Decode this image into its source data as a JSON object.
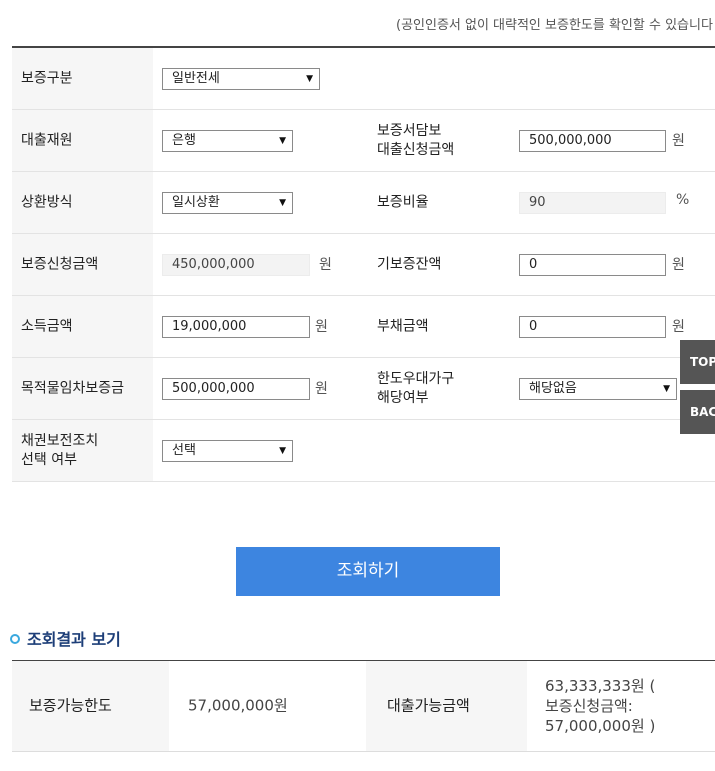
{
  "notice": "(공인인증서 없이 대략적인 보증한도를 확인할 수 있습니다",
  "form": {
    "guarantee_type": {
      "label": "보증구분",
      "value": "일반전세"
    },
    "loan_source": {
      "label": "대출재원",
      "value": "은행"
    },
    "collateral_amount": {
      "label": "보증서담보\n대출신청금액",
      "value": "500,000,000",
      "unit": "원"
    },
    "repayment": {
      "label": "상환방식",
      "value": "일시상환"
    },
    "guarantee_ratio": {
      "label": "보증비율",
      "value": "90",
      "unit": "%"
    },
    "applied_amount": {
      "label": "보증신청금액",
      "value": "450,000,000",
      "unit": "원"
    },
    "existing_balance": {
      "label": "기보증잔액",
      "value": "0",
      "unit": "원"
    },
    "income": {
      "label": "소득금액",
      "value": "19,000,000",
      "unit": "원"
    },
    "debt": {
      "label": "부채금액",
      "value": "0",
      "unit": "원"
    },
    "lease_deposit": {
      "label": "목적물임차보증금",
      "value": "500,000,000",
      "unit": "원"
    },
    "preferred_household": {
      "label": "한도우대가구\n해당여부",
      "value": "해당없음"
    },
    "bond_preservation": {
      "label": "채권보전조치\n선택 여부",
      "value": "선택"
    }
  },
  "side": {
    "top": "TOP",
    "back": "BACK"
  },
  "submit_label": "조회하기",
  "result": {
    "title": "조회결과 보기",
    "limit_label": "보증가능한도",
    "limit_value": "57,000,000원",
    "loan_label": "대출가능금액",
    "loan_value": "63,333,333원 (\n보증신청금액:\n57,000,000원 )"
  },
  "icons": {
    "dropdown": "chevron-down-icon",
    "bullet": "circle-bullet-icon"
  },
  "colors": {
    "accent": "#3d85e0",
    "title": "#1d3e78",
    "side_button": "#555555"
  }
}
